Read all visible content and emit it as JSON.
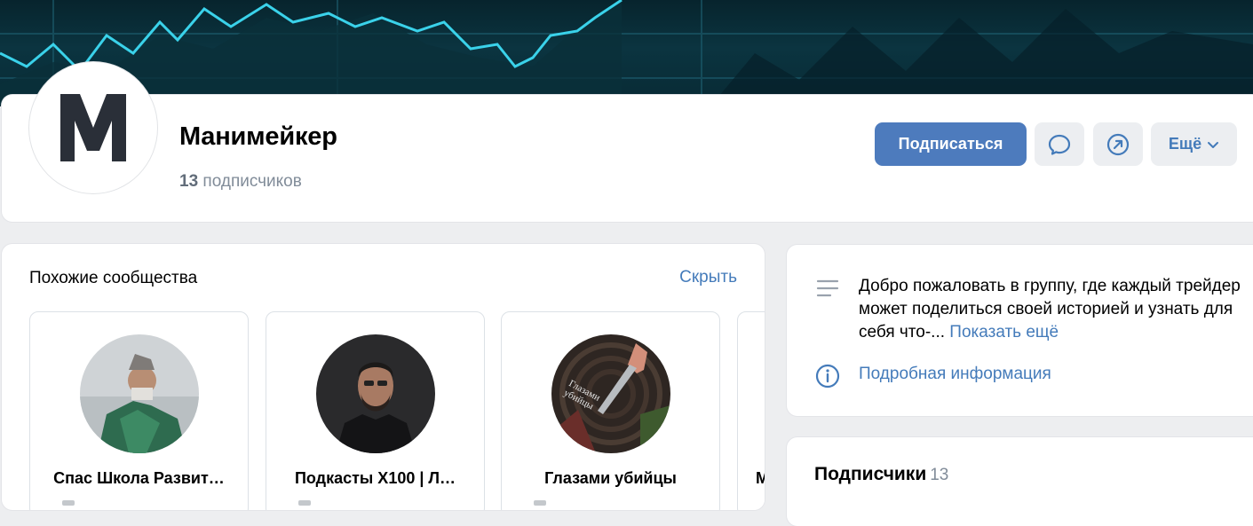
{
  "group": {
    "name": "Манимейкер",
    "avatar_letter": "M",
    "subscribers_num": "13",
    "subscribers_label": "подписчиков"
  },
  "actions": {
    "subscribe_label": "Подписаться",
    "message_icon": "message-bubble-icon",
    "share_icon": "share-arrow-icon",
    "more_label": "Ещё"
  },
  "similar": {
    "title": "Похожие сообщества",
    "hide_label": "Скрыть",
    "items": [
      {
        "name": "Спас Школа Развит…"
      },
      {
        "name": "Подкасты X100 | Л…"
      },
      {
        "name": "Глазами убийцы",
        "photo_caption": "Глазами убийцы"
      },
      {
        "name": "М"
      }
    ]
  },
  "info": {
    "description": "Добро пожаловать в группу, где каждый трейдер может поделиться своей историей и узнать для себя что-...",
    "show_more": "Показать ещё",
    "details_link": "Подробная информация"
  },
  "subscribers_block": {
    "title": "Подписчики",
    "count": "13"
  },
  "colors": {
    "accent": "#447bba",
    "primary_button": "#4d7bbd",
    "page_bg": "#edeef0",
    "secondary_text": "#818c99"
  }
}
